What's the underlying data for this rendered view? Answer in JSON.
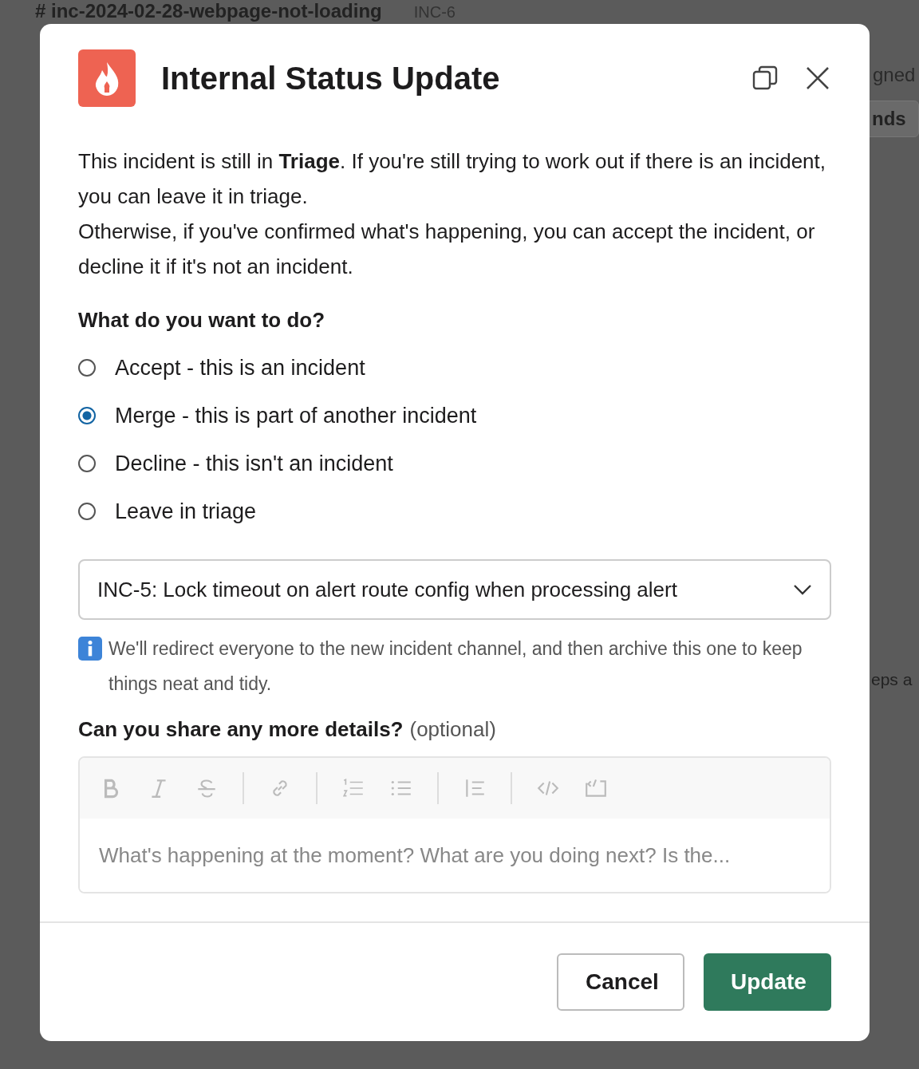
{
  "background": {
    "channel_title": "# inc-2024-02-28-webpage-not-loading",
    "incident_id": "INC-6",
    "side_text": "gned",
    "side_button": "nds",
    "body_fragment": "eps a"
  },
  "modal": {
    "title": "Internal Status Update",
    "intro": [
      "This incident is still in **Triage**. If you're still trying to work out if there is an incident, you can leave it in triage.",
      "Otherwise, if you've confirmed what's happening, you can accept the incident, or decline it if it's not an incident."
    ],
    "question": "What do you want to do?",
    "options": [
      {
        "label": "Accept - this is an incident",
        "selected": false
      },
      {
        "label": "Merge - this is part of another incident",
        "selected": true
      },
      {
        "label": "Decline - this isn't an incident",
        "selected": false
      },
      {
        "label": "Leave in triage",
        "selected": false
      }
    ],
    "merge_target": "INC-5: Lock timeout on alert route config when processing alert",
    "info": "We'll redirect everyone to the new incident channel, and then archive this one to keep things neat and tidy.",
    "details_label": "Can you share any more details?",
    "details_hint": "(optional)",
    "details_placeholder": "What's happening at the moment? What are you doing next? Is the...",
    "buttons": {
      "cancel": "Cancel",
      "submit": "Update"
    }
  }
}
